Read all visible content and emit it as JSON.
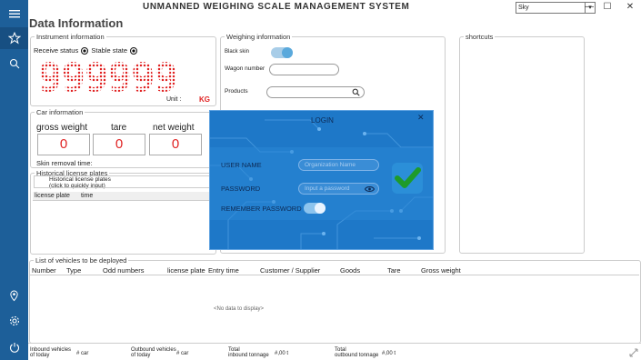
{
  "app": {
    "title": "UNMANNED WEIGHING SCALE MANAGEMENT SYSTEM",
    "theme": "Sky",
    "page_title": "Data Information"
  },
  "window": {
    "minimize": "—",
    "maximize": "☐",
    "close": "✕"
  },
  "rail": {
    "icons": [
      "menu-icon",
      "star-icon",
      "search-icon",
      "location-icon",
      "settings-icon",
      "power-icon"
    ]
  },
  "instrument": {
    "legend": "Instrument information",
    "receive_status": "Receive status",
    "stable_state": "Stable state",
    "display": "999999",
    "unit_label": "Unit :",
    "unit": "KG"
  },
  "car": {
    "legend": "Car information",
    "gross_label": "gross weight",
    "tare_label": "tare",
    "net_label": "net weight",
    "gross": "0",
    "tare": "0",
    "net": "0",
    "skin_removal": "Skin removal time:"
  },
  "history": {
    "legend": "Historical license plates",
    "hint_line1": "Historical license plates",
    "hint_line2": "(click to quickly input)",
    "col_plate": "license plate",
    "col_time": "time"
  },
  "weighing": {
    "legend": "Weighing information",
    "black_skin": "Black skin",
    "wagon_number": "Wagon number",
    "products": "Products"
  },
  "shortcuts": {
    "legend": "shortcuts"
  },
  "vehicles": {
    "legend": "List of vehicles to be deployed",
    "columns": [
      "Number",
      "Type",
      "Odd numbers",
      "license plate",
      "Entry time",
      "Customer / Supplier",
      "Goods",
      "Tare",
      "Gross weight"
    ],
    "empty": "<No data to display>"
  },
  "login": {
    "title": "LOGIN",
    "user_label": "USER NAME",
    "user_placeholder": "Organization Name",
    "password_label": "PASSWORD",
    "password_placeholder": "Input a password",
    "remember_label": "REMEMBER PASSWORD",
    "remember_on": true,
    "close": "✕"
  },
  "footer": {
    "inbound_label_1": "Inbound vehicles",
    "inbound_label_2": "of today",
    "inbound_value": "# car",
    "outbound_label_1": "Outbound vehicles",
    "outbound_label_2": "of today",
    "outbound_value": "# car",
    "in_ton_label_1": "Total",
    "in_ton_label_2": "inbound tonnage",
    "in_ton_value": "#,00 t",
    "out_ton_label_1": "Total",
    "out_ton_label_2": "outbound tonnage",
    "out_ton_value": "#,00 t"
  }
}
